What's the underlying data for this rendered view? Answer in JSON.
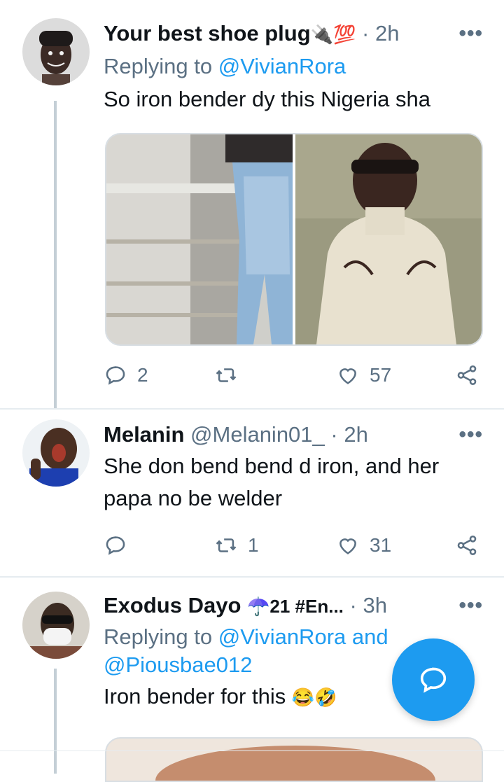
{
  "tweets": [
    {
      "name": "Your best shoe plug",
      "name_emoji": "🔌💯",
      "handle": "",
      "time": "· 2h",
      "reply_prefix": "Replying to ",
      "reply_mention": "@VivianRora",
      "reply_mention2": "",
      "text": "So iron bender dy this Nigeria sha",
      "replies": "2",
      "retweets": "",
      "likes": "57"
    },
    {
      "name": "Melanin",
      "handle": "@Melanin01_",
      "time": "· 2h",
      "text": "She don bend bend d iron, and her papa no be welder",
      "replies": "",
      "retweets": "1",
      "likes": "31"
    },
    {
      "name": "Exodus Dayo",
      "name_emoji": "☂️21 #En...",
      "handle": "",
      "time": "· 3h",
      "reply_prefix": "Replying to ",
      "reply_mention": "@VivianRora and",
      "reply_mention2": "@Piousbae012",
      "text": "Iron bender for this",
      "text_emoji": "😂🤣"
    }
  ],
  "more_label": "•••",
  "icons": {
    "reply": "reply-icon",
    "retweet": "retweet-icon",
    "like": "heart-icon",
    "share": "share-icon",
    "compose": "compose-reply-icon"
  },
  "colors": {
    "accent": "#1d9bf0",
    "muted": "#5b7083"
  }
}
